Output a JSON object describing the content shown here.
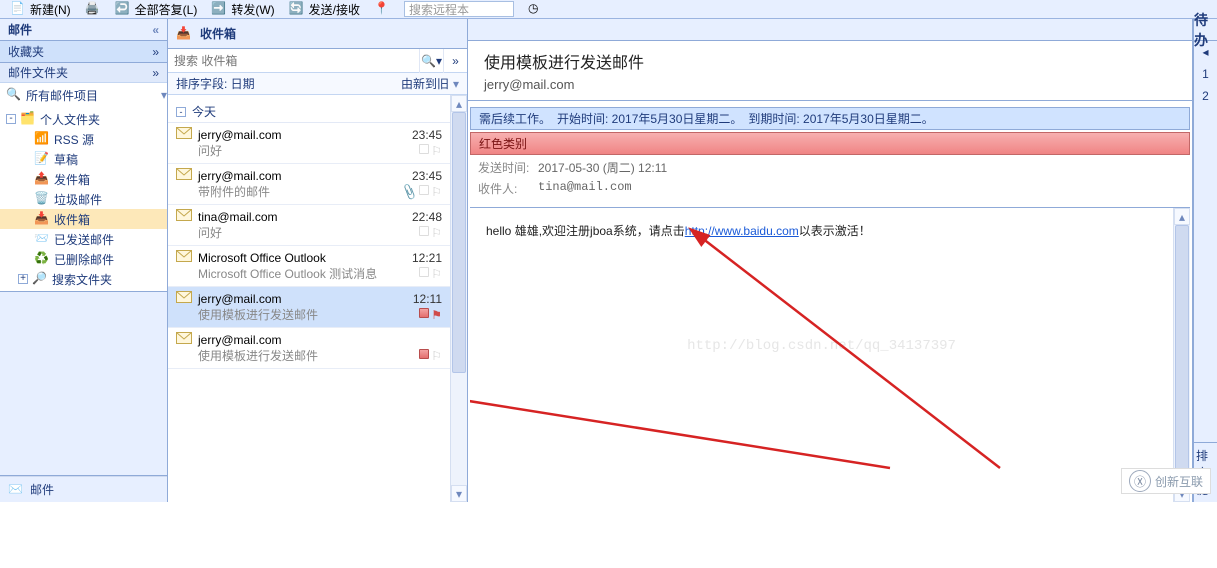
{
  "toolbar": {
    "new": "新建(N)",
    "reply_all": "全部答复(L)",
    "forward": "转发(W)",
    "sendreceive": "发送/接收",
    "search_placeholder": "搜索远程本"
  },
  "nav": {
    "title": "邮件",
    "chevrons": "«",
    "favorites": "收藏夹",
    "fav_chev": "»",
    "section": "邮件文件夹",
    "sec_chev": "»",
    "all_items": "所有邮件项目",
    "tree": {
      "personal": "个人文件夹",
      "rss": "RSS 源",
      "drafts": "草稿",
      "outbox": "发件箱",
      "junk": "垃圾邮件",
      "inbox": "收件箱",
      "sent": "已发送邮件",
      "deleted": "已删除邮件",
      "search": "搜索文件夹"
    },
    "bottom_mail": "邮件"
  },
  "list": {
    "title": "收件箱",
    "search_placeholder": "搜索 收件箱",
    "sort_field": "排序字段: 日期",
    "sort_order": "由新到旧",
    "group_today": "今天",
    "items": [
      {
        "from": "jerry@mail.com",
        "time": "23:45",
        "subject": "问好"
      },
      {
        "from": "jerry@mail.com",
        "time": "23:45",
        "subject": "带附件的邮件",
        "attachment": true
      },
      {
        "from": "tina@mail.com",
        "time": "22:48",
        "subject": "问好"
      },
      {
        "from": "Microsoft Office Outlook",
        "time": "12:21",
        "subject": "Microsoft Office Outlook 测试消息"
      },
      {
        "from": "jerry@mail.com",
        "time": "12:11",
        "subject": "使用模板进行发送邮件",
        "selected": true,
        "category_red": true,
        "flag": true
      },
      {
        "from": "jerry@mail.com",
        "time": "",
        "subject": "使用模板进行发送邮件",
        "category_red": true
      }
    ]
  },
  "reading": {
    "subject": "使用模板进行发送邮件",
    "from": "jerry@mail.com",
    "followup": "需后续工作。　开始时间: 2017年5月30日星期二。　到期时间: 2017年5月30日星期二。",
    "category": "红色类别",
    "sent_label": "发送时间:",
    "sent_value": "2017-05-30 (周二) 12:11",
    "to_label": "收件人:",
    "to_value": "tina@mail.com",
    "body_prefix": "hello 雄雄,欢迎注册jboa系统，请点击",
    "body_link": "http://www.baidu.com",
    "body_suffix": "以表示激活！"
  },
  "todo": {
    "header": "待办",
    "sort": "排序",
    "key": "键"
  },
  "watermark": "http://blog.csdn.net/qq_34137397",
  "logo": "创新互联"
}
